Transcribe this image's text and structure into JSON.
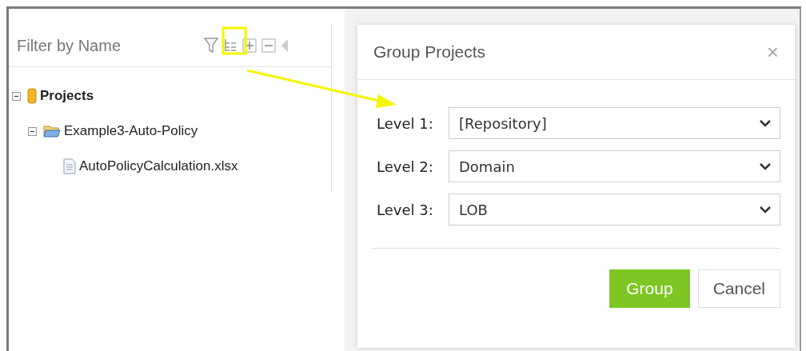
{
  "filter": {
    "placeholder": "Filter by Name"
  },
  "tree": [
    {
      "label": "Projects",
      "kind": "repository",
      "expanded": true,
      "children": [
        {
          "label": "Example3-Auto-Policy",
          "kind": "folder",
          "expanded": true,
          "children": [
            {
              "label": "AutoPolicyCalculation.xlsx",
              "kind": "file"
            }
          ]
        }
      ]
    }
  ],
  "dialog": {
    "title": "Group Projects",
    "close": "×",
    "levels": [
      {
        "label": "Level 1:",
        "value": "[Repository]"
      },
      {
        "label": "Level 2:",
        "value": "Domain"
      },
      {
        "label": "Level 3:",
        "value": "LOB"
      }
    ],
    "buttons": [
      {
        "label": "Group",
        "kind": "primary"
      },
      {
        "label": "Cancel",
        "kind": "secondary"
      }
    ]
  }
}
